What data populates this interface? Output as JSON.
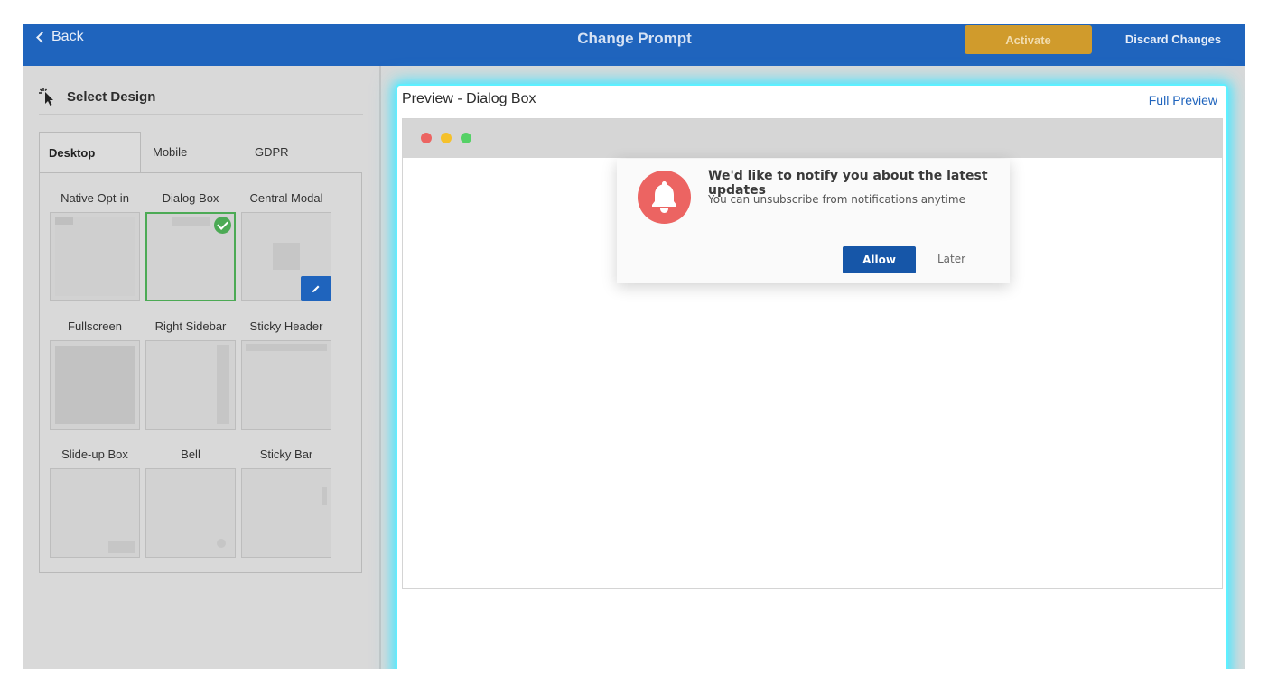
{
  "topbar": {
    "back_label": "Back",
    "title": "Change Prompt",
    "activate_label": "Activate",
    "discard_label": "Discard Changes"
  },
  "left": {
    "heading": "Select Design",
    "tabs": [
      {
        "label": "Desktop",
        "active": true
      },
      {
        "label": "Mobile",
        "active": false
      },
      {
        "label": "GDPR",
        "active": false
      }
    ],
    "designs": [
      {
        "label": "Native Opt-in"
      },
      {
        "label": "Dialog Box",
        "selected": true
      },
      {
        "label": "Central Modal",
        "editable": true
      },
      {
        "label": "Fullscreen"
      },
      {
        "label": "Right Sidebar"
      },
      {
        "label": "Sticky Header"
      },
      {
        "label": "Slide-up Box"
      },
      {
        "label": "Bell"
      },
      {
        "label": "Sticky Bar"
      }
    ]
  },
  "preview": {
    "title": "Preview - Dialog Box",
    "full_preview_label": "Full Preview",
    "dialog": {
      "title": "We'd like to notify you about the latest updates",
      "subtitle": "You can unsubscribe from notifications anytime",
      "allow_label": "Allow",
      "later_label": "Later"
    }
  },
  "colors": {
    "topbar": "#1f64bd",
    "activate": "#d09b2c",
    "selected_border": "#4caa55",
    "allow_button": "#1656a8",
    "bell_circle": "#ec6462",
    "glow": "#4de6ff"
  },
  "icons": {
    "back": "chevron-left-icon",
    "select_design": "cursor-click-icon",
    "selected": "check-circle-icon",
    "edit": "pencil-icon",
    "bell": "bell-icon"
  }
}
